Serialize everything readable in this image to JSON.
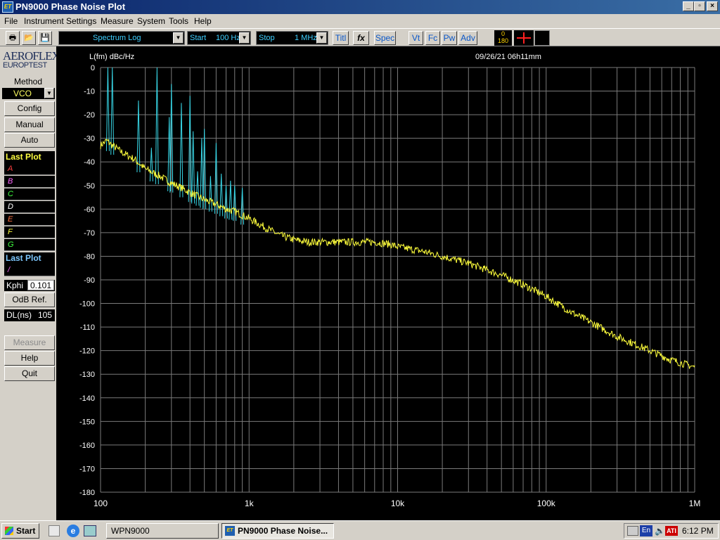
{
  "window": {
    "title": "PN9000 Phase Noise Plot",
    "icon_text": "ET"
  },
  "menu": [
    "File",
    "Instrument",
    "Settings",
    "Measure",
    "System",
    "Tools",
    "Help"
  ],
  "toolbar": {
    "mode": "Spectrum Log",
    "start_label": "Start",
    "start_value": "100 Hz",
    "stop_label": "Stop",
    "stop_value": "1 MHz",
    "buttons": [
      "Titl",
      "Spec",
      "Vt",
      "Fc",
      "Pw",
      "Adv"
    ],
    "fx_label": "fx",
    "phase_top": "0",
    "phase_bottom": "180"
  },
  "left": {
    "logo_top": "AEROFLEX",
    "logo_bottom": "EUROPTEST",
    "method_label": "Method",
    "method_value": "VCO",
    "config": "Config",
    "manual": "Manual",
    "auto": "Auto",
    "last_plot_1": "Last Plot",
    "slots": [
      "A",
      "B",
      "C",
      "D",
      "E",
      "F",
      "G"
    ],
    "last_plot_2": "Last Plot",
    "slot_last": "/",
    "kphi_label": "Kphi",
    "kphi_value": "0.101",
    "odb_ref": "OdB Ref.",
    "dl_label": "DL(ns)",
    "dl_value": "105",
    "measure": "Measure",
    "help": "Help",
    "quit": "Quit"
  },
  "colors": {
    "trace": "#ffff3c",
    "spur": "#38d8e8",
    "grid": "#7a7a7a",
    "slot_colors": [
      "#ff4040",
      "#ff66ff",
      "#40ff40",
      "#ffffff",
      "#ff7040",
      "#ffff40",
      "#40ff40"
    ]
  },
  "chart_data": {
    "type": "line",
    "title": "",
    "ylabel": "L(fm) dBc/Hz",
    "date_text": "09/26/21   06h11mm",
    "x_scale": "log",
    "xlim": [
      100,
      1000000
    ],
    "ylim": [
      -180,
      0
    ],
    "grid": true,
    "x_ticks": [
      {
        "value": 100,
        "label": "100"
      },
      {
        "value": 1000,
        "label": "1k"
      },
      {
        "value": 10000,
        "label": "10k"
      },
      {
        "value": 100000,
        "label": "100k"
      },
      {
        "value": 1000000,
        "label": "1M"
      }
    ],
    "y_ticks": [
      0,
      -10,
      -20,
      -30,
      -40,
      -50,
      -60,
      -70,
      -80,
      -90,
      -100,
      -110,
      -120,
      -130,
      -140,
      -150,
      -160,
      -170,
      -180
    ],
    "series": [
      {
        "x": [
          100,
          110,
          120,
          140,
          170,
          200,
          250,
          300,
          350,
          400,
          500,
          600,
          700,
          800,
          1000,
          1300,
          1600,
          2000,
          2500,
          3000,
          4000,
          5000,
          6000,
          7000,
          8000,
          9000,
          10000,
          15000,
          20000,
          30000,
          50000,
          70000,
          100000,
          150000,
          200000,
          300000,
          500000,
          700000,
          1000000
        ],
        "y": [
          -33,
          -31,
          -33,
          -36,
          -39,
          -43,
          -46,
          -49,
          -51,
          -53,
          -56,
          -58,
          -60,
          -61,
          -64,
          -68,
          -71,
          -73,
          -74,
          -74,
          -74,
          -74,
          -74,
          -74,
          -74.5,
          -75,
          -76,
          -78,
          -80,
          -83,
          -88,
          -92,
          -97,
          -104,
          -108,
          -114,
          -120,
          -124,
          -127
        ]
      }
    ],
    "spurs": [
      {
        "x": 112,
        "y": 0
      },
      {
        "x": 120,
        "y": 0
      },
      {
        "x": 180,
        "y": -14
      },
      {
        "x": 220,
        "y": -34
      },
      {
        "x": 240,
        "y": 0
      },
      {
        "x": 290,
        "y": -21
      },
      {
        "x": 300,
        "y": -7
      },
      {
        "x": 350,
        "y": -15
      },
      {
        "x": 400,
        "y": -12
      },
      {
        "x": 420,
        "y": -27
      },
      {
        "x": 450,
        "y": -44
      },
      {
        "x": 480,
        "y": -30
      },
      {
        "x": 500,
        "y": -26
      },
      {
        "x": 550,
        "y": -46
      },
      {
        "x": 600,
        "y": -32
      },
      {
        "x": 650,
        "y": -45
      },
      {
        "x": 700,
        "y": -50
      },
      {
        "x": 750,
        "y": -48
      },
      {
        "x": 800,
        "y": -50
      },
      {
        "x": 900,
        "y": -51
      }
    ]
  },
  "taskbar": {
    "start": "Start",
    "task1": "WPN9000",
    "task2": "PN9000 Phase Noise...",
    "lang": "En",
    "time": "6:12 PM"
  }
}
